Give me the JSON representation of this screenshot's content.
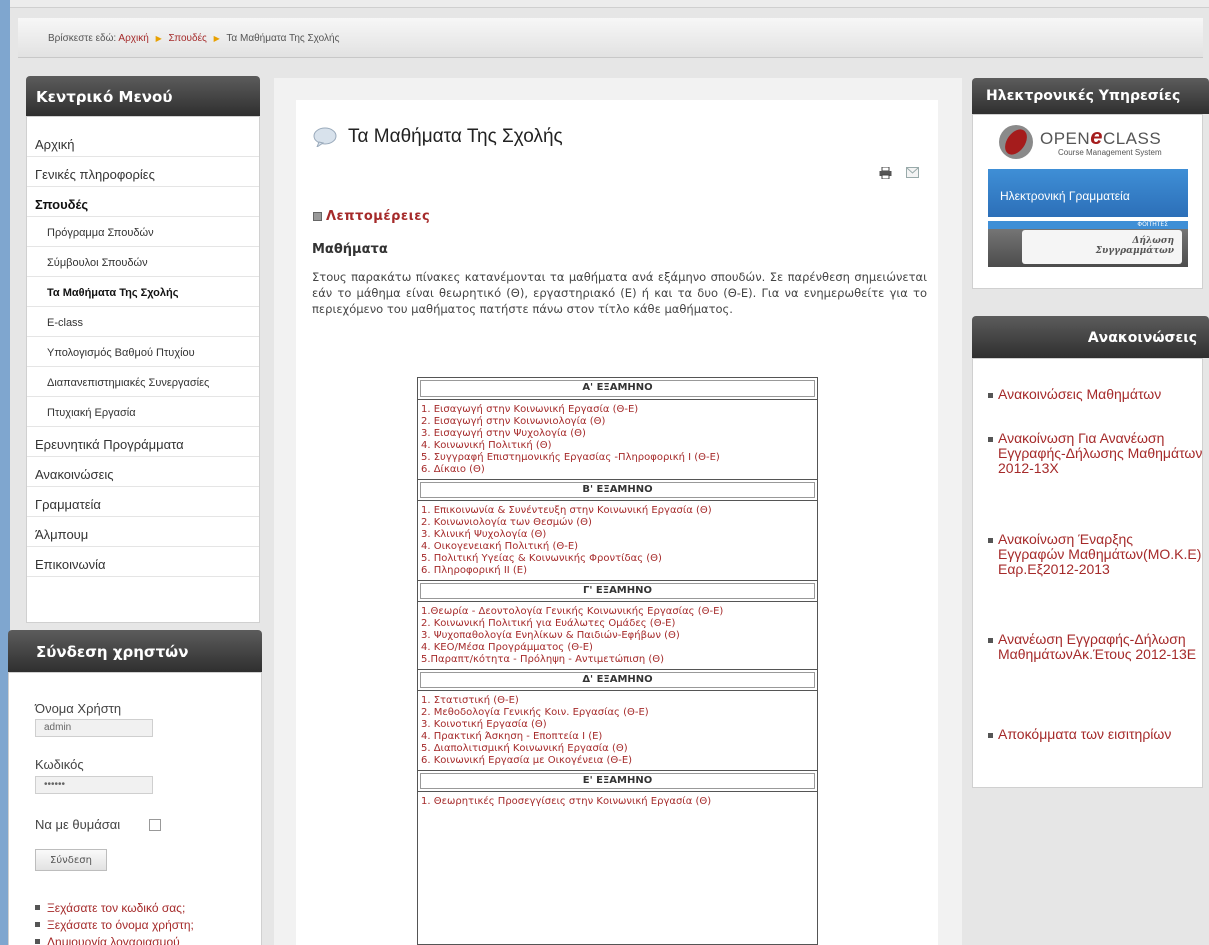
{
  "breadcrumb": {
    "prefix": "Βρίσκεστε εδώ:",
    "items": [
      "Αρχική",
      "Σπουδές",
      "Τα Μαθήματα Της Σχολής"
    ]
  },
  "main_menu": {
    "title": "Κεντρικό Μενού",
    "items": [
      {
        "label": "Αρχική"
      },
      {
        "label": "Γενικές πληροφορίες"
      },
      {
        "label": "Σπουδές"
      },
      {
        "label": "Πρόγραμμα Σπουδών"
      },
      {
        "label": "Σύμβουλοι Σπουδών"
      },
      {
        "label": "Τα Μαθήματα Της Σχολής"
      },
      {
        "label": "E-class"
      },
      {
        "label": "Υπολογισμός Βαθμού Πτυχίου"
      },
      {
        "label": "Διαπανεπιστημιακές Συνεργασίες"
      },
      {
        "label": "Πτυχιακή Εργασία"
      },
      {
        "label": "Ερευνητικά Προγράμματα"
      },
      {
        "label": "Ανακοινώσεις"
      },
      {
        "label": "Γραμματεία"
      },
      {
        "label": "Άλμπουμ"
      },
      {
        "label": "Επικοινωνία"
      }
    ]
  },
  "login": {
    "title": "Σύνδεση χρηστών",
    "username_label": "Όνομα Χρήστη",
    "username_value": "admin",
    "password_label": "Κωδικός",
    "password_value": "••••••",
    "remember_label": "Να με θυμάσαι",
    "submit_label": "Σύνδεση",
    "links": [
      "Ξεχάσατε τον κωδικό σας;",
      "Ξεχάσατε το όνομα χρήστη;",
      "Δημιουργία λογαριασμού"
    ]
  },
  "content": {
    "title": "Τα Μαθήματα Της Σχολής",
    "details_link": "Λεπτομέρειες",
    "heading": "Μαθήματα",
    "intro": "Στους παρακάτω πίνακες κατανέμονται τα μαθήματα ανά εξάμηνο σπουδών. Σε παρένθεση σημειώνεται εάν το μάθημα είναι θεωρητικό (Θ), εργαστηριακό (Ε) ή και τα δυο (Θ-Ε). Για να ενημερωθείτε για το περιεχόμενο του μαθήματος πατήστε πάνω στον τίτλο κάθε μαθήματος."
  },
  "semesters": [
    {
      "title": "Α' ΕΞΑΜΗΝΟ",
      "courses": [
        "1. Εισαγωγή στην Κοινωνική Εργασία (Θ-Ε)",
        "2. Εισαγωγή στην Κοινωνιολογία (Θ)",
        "3. Εισαγωγή στην Ψυχολογία (Θ)",
        "4. Κοινωνική Πολιτική (Θ)",
        "5. Συγγραφή Επιστημονικής Εργασίας -Πληροφορική Ι (Θ-Ε)",
        "6. Δίκαιο (Θ)"
      ]
    },
    {
      "title": "Β' ΕΞΑΜΗΝΟ",
      "courses": [
        "1. Επικοινωνία & Συνέντευξη στην Κοινωνική Εργασία (Θ)",
        "2. Κοινωνιολογία των Θεσμών (Θ)",
        "3. Κλινική Ψυχολογία (Θ)",
        "4. Οικογενειακή Πολιτική (Θ-Ε)",
        "5. Πολιτική Υγείας & Κοινωνικής Φροντίδας (Θ)",
        "6. Πληροφορική ΙΙ (Ε)"
      ]
    },
    {
      "title": "Γ' ΕΞΑΜΗΝΟ",
      "courses": [
        "1.Θεωρία - Δεοντολογία Γενικής Κοινωνικής Εργασίας (Θ-Ε)",
        "2. Κοινωνική Πολιτική για Ευάλωτες Ομάδες (Θ-Ε)",
        "3. Ψυχοπαθολογία Ενηλίκων & Παιδιών-Εφήβων (Θ)",
        "4. ΚΕΟ/Μέσα Προγράμματος (Θ-Ε)",
        "5.Παραπτ/κότητα - Πρόληψη - Αντιμετώπιση (Θ)"
      ]
    },
    {
      "title": "Δ' ΕΞΑΜΗΝΟ",
      "courses": [
        "1. Στατιστική (Θ-Ε)",
        "2. Μεθοδολογία Γενικής Κοιν. Εργασίας (Θ-Ε)",
        "3. Κοινοτική Εργασία (Θ)",
        "4. Πρακτική Άσκηση - Εποπτεία Ι (Ε)",
        "5. Διαπολιτισμική Κοινωνική Εργασία (Θ)",
        "6. Κοινωνική Εργασία με Οικογένεια (Θ-Ε)"
      ]
    },
    {
      "title": "Ε' ΕΞΑΜΗΝΟ",
      "courses": [
        "1. Θεωρητικές Προσεγγίσεις στην Κοινωνική Εργασία (Θ)"
      ]
    }
  ],
  "services": {
    "title": "Ηλεκτρονικές Υπηρεσίες",
    "openeclass_name": "OPEN",
    "openeclass_e": "e",
    "openeclass_class": "CLASS",
    "openeclass_tagline": "Course Management System",
    "grammateia": "Ηλεκτρονική Γραμματεία",
    "students_tag": "ΦΟΙΤΗΤΕΣ",
    "syggrammata_line1": "Δήλωση",
    "syggrammata_line2": "Συγγραμμάτων"
  },
  "announcements": {
    "title": "Ανακοινώσεις",
    "items": [
      "Ανακοινώσεις Μαθημάτων",
      "Ανακοίνωση Για Ανανέωση Εγγραφής-Δήλωσης Μαθημάτων 2012-13Χ",
      "Ανακοίνωση Έναρξης Εγγραφών Μαθημάτων(ΜΟ.Κ.Ε) Εαρ.Εξ2012-2013",
      "Ανανέωση Εγγραφής-Δήλωση ΜαθημάτωνΑκ.Έτους 2012-13Ε",
      "Αποκόμματα των εισιτηρίων"
    ]
  },
  "colors": {
    "link": "#a52a2a",
    "header_dark": "#3a3a3a",
    "accent_blue": "#3f8fd6"
  }
}
